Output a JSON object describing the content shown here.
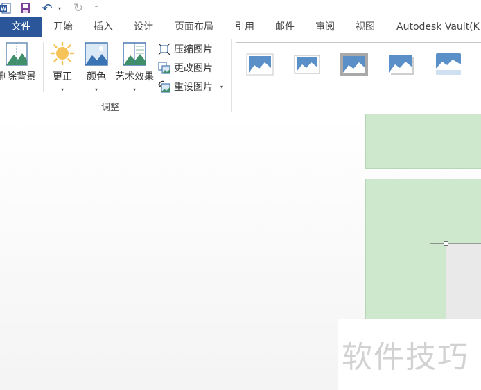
{
  "quick_access": {
    "app_icon": "word-icon",
    "save_icon": "save-icon",
    "undo_icon": "undo-icon",
    "redo_icon": "redo-icon",
    "undo_dropdown": "▾",
    "customize": "⁼"
  },
  "tabs": [
    {
      "label": "文件",
      "active": true
    },
    {
      "label": "开始"
    },
    {
      "label": "插入"
    },
    {
      "label": "设计"
    },
    {
      "label": "页面布局"
    },
    {
      "label": "引用"
    },
    {
      "label": "邮件"
    },
    {
      "label": "审阅"
    },
    {
      "label": "视图"
    },
    {
      "label": "Autodesk Vault(K"
    }
  ],
  "ribbon": {
    "remove_background": "删除背景",
    "corrections": "更正",
    "color": "颜色",
    "artistic_effects": "艺术效果",
    "compress_pictures": "压缩图片",
    "change_picture": "更改图片",
    "reset_picture": "重设图片",
    "group_adjust": "调整",
    "dropdown": "▾"
  },
  "picture_styles": [
    {
      "name": "simple-frame-white"
    },
    {
      "name": "simple-frame-thin"
    },
    {
      "name": "beveled-matte-gray"
    },
    {
      "name": "drop-shadow-rectangle"
    },
    {
      "name": "reflected-rounded"
    }
  ],
  "document": {
    "watermark": "软件技巧"
  },
  "colors": {
    "accent": "#2b579a",
    "page_fill": "#cde8cd",
    "image_fill": "#e9e9e9"
  }
}
